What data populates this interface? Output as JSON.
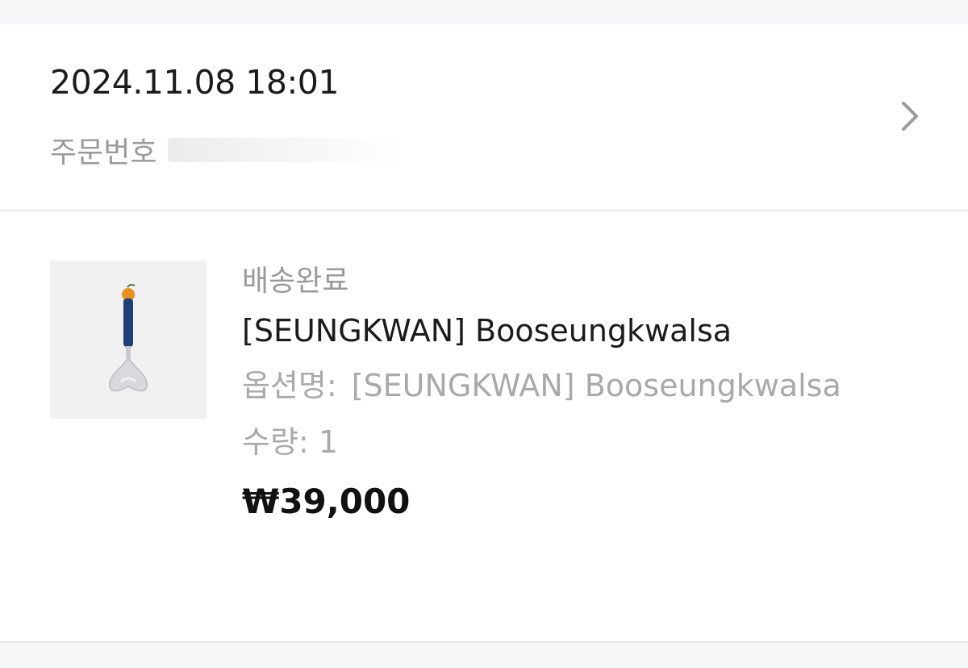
{
  "order": {
    "date": "2024.11.08 18:01",
    "number_label": "주문번호",
    "chevron_icon": "chevron-right-icon"
  },
  "item": {
    "status": "배송완료",
    "name": "[SEUNGKWAN] Booseungkwalsa",
    "option_label": "옵션명:",
    "option_value": "[SEUNGKWAN] Booseungkwalsa",
    "quantity_label": "수량:",
    "quantity": "1",
    "price": "₩39,000",
    "image_icon": "product-thumbnail-image"
  },
  "colors": {
    "background": "#f6f8fa",
    "card": "#ffffff",
    "primary_text": "#1b1b1b",
    "secondary_text": "#9a9a9a",
    "accent_orange": "#e8901f",
    "accent_navy": "#1f3f7a"
  }
}
